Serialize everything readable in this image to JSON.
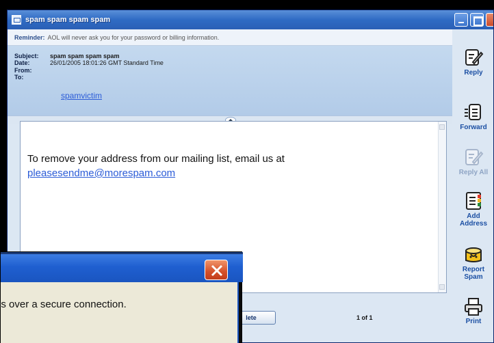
{
  "window": {
    "title": "spam spam spam spam"
  },
  "reminder": {
    "label": "Reminder:",
    "text": "AOL will never ask you for your password or billing information."
  },
  "header": {
    "subject_label": "Subject:",
    "subject": "spam spam spam spam",
    "date_label": "Date:",
    "date": "26/01/2005 18:01:26 GMT Standard Time",
    "from_label": "From:",
    "from": "",
    "to_label": "To:",
    "to": "spamvictim"
  },
  "body": {
    "text": "To remove your address from our mailing list, email us at",
    "link": "pleasesendme@morespam.com"
  },
  "footer": {
    "delete_label": "lete",
    "page_counter": "1 of 1"
  },
  "toolbar": {
    "reply": "Reply",
    "forward": "Forward",
    "reply_all": "Reply All",
    "add_address": [
      "Add",
      "Address"
    ],
    "report_spam": [
      "Report",
      "Spam"
    ],
    "print": "Print"
  },
  "dialog": {
    "message": "es over a secure connection."
  },
  "colors": {
    "titlebar": "#2f6bc4",
    "header_panel": "#b2cbe8",
    "link": "#2a5bd7",
    "toolbar_text": "#1b4fa3",
    "dialog_close": "#d4502a"
  }
}
